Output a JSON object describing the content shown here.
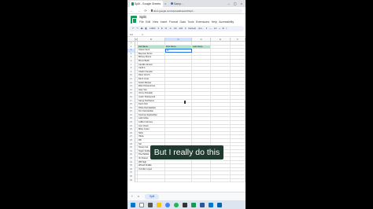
{
  "browser": {
    "tabs": [
      {
        "label": "Split - Google Sheets"
      },
      {
        "label": "Samp..."
      }
    ],
    "url": "docs.google.com/spreadsheets/d/1qC..."
  },
  "doc": {
    "title": "Split",
    "menus": [
      "File",
      "Edit",
      "View",
      "Insert",
      "Format",
      "Data",
      "Tools",
      "Extensions",
      "Help",
      "Accessibility"
    ],
    "toolbar": "↶ ↷ 🖶 ◧ 100% ▾ $ % .0 .00 123 ▾ Default (Ari... ▾ — 10 + B I",
    "name_box": "C3",
    "fx": "fx"
  },
  "grid": {
    "columns": [
      "A",
      "B",
      "C",
      "D",
      "E",
      "F"
    ],
    "header_row": {
      "full_name": "Full Name",
      "first_name": "First Name",
      "last_name": "Last Name"
    },
    "active_cell_value": "Ar",
    "names": [
      "Ariana Venti",
      "Beyonce Knors",
      "Britney Divers",
      "Bruno Barth",
      "Camilla Jamser",
      "Cardi A",
      "Charli C'Amelio",
      "Dave Grinch",
      "Demi Lover",
      "Dustin Beaver",
      "Ellen DeGenerous",
      "Gary Ves",
      "Jimmy Donaldo",
      "Justin Timberpond",
      "Kanye Northwest",
      "Kevin Fart",
      "Khloe Doordashian",
      "Kim Cancashian",
      "Kourtney Eyelashian",
      "Lady Hoka",
      "LeBron Farmes",
      "Lion Clown",
      "Miley Cyber",
      "Nicki",
      "Olivia",
      "Rih",
      "Sel",
      "Snoop Cat",
      "Taylor Sniffed",
      "The Pebble",
      "Vin Diesel",
      "Will Sigh",
      "Wizard Khalife",
      "Yennifer Lopez"
    ]
  },
  "sheets": {
    "add": "+",
    "list": "≡",
    "active": "Split"
  },
  "caption": "But I really do this"
}
